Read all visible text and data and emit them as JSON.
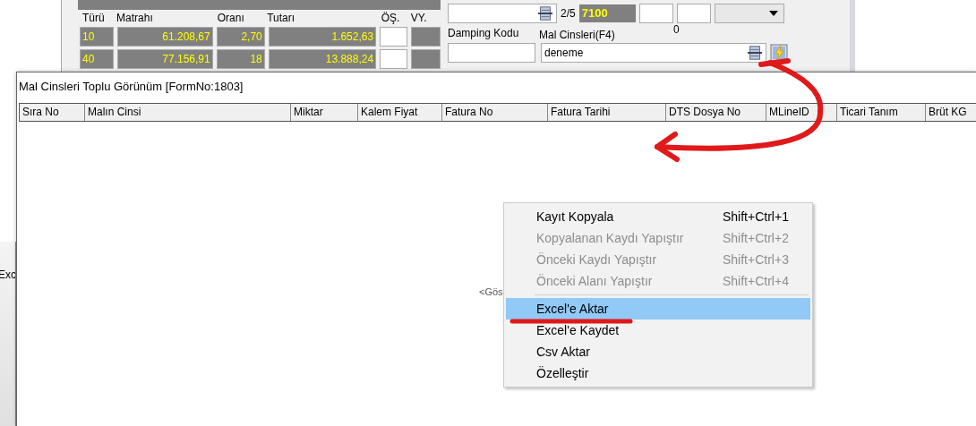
{
  "background_form": {
    "tax_table": {
      "columns": [
        "Türü",
        "Matrahı",
        "Oranı",
        "Tutarı",
        "ÖŞ.",
        "VY."
      ],
      "rows": [
        {
          "type": "10",
          "base": "61.208,67",
          "rate": "2,70",
          "amount": "1.652,63",
          "checked": false
        },
        {
          "type": "40",
          "base": "77.156,91",
          "rate": "18",
          "amount": "13.888,24",
          "checked": false
        }
      ]
    },
    "pager": "2/5",
    "code": "7100",
    "count": "0",
    "damping_label": "Damping Kodu",
    "goods_label": "Mal Cinsleri(F4)",
    "goods_value": "deneme",
    "side_tab": "Exc"
  },
  "window": {
    "title": "Mal Cinsleri Toplu Görünüm [FormNo:1803]",
    "columns": [
      "Sıra No",
      "Malın Cinsi",
      "Miktar",
      "Kalem Fiyat",
      "Fatura No",
      "Fatura Tarihi",
      "DTS Dosya No",
      "MLineID",
      "Ticari Tanım",
      "Brüt KG"
    ],
    "empty_text": "<Gös"
  },
  "context_menu": {
    "items": [
      {
        "kind": "item",
        "label": "Kayıt Kopyala",
        "shortcut": "Shift+Ctrl+1",
        "disabled": false,
        "selected": false
      },
      {
        "kind": "item",
        "label": "Kopyalanan Kaydı Yapıştır",
        "shortcut": "Shift+Ctrl+2",
        "disabled": true,
        "selected": false
      },
      {
        "kind": "item",
        "label": "Önceki Kaydı Yapıştır",
        "shortcut": "Shift+Ctrl+3",
        "disabled": true,
        "selected": false
      },
      {
        "kind": "item",
        "label": "Önceki Alanı Yapıştır",
        "shortcut": "Shift+Ctrl+4",
        "disabled": true,
        "selected": false
      },
      {
        "kind": "separator"
      },
      {
        "kind": "item",
        "label": "Excel'e Aktar",
        "disabled": false,
        "selected": true
      },
      {
        "kind": "item",
        "label": "Excel'e Kaydet",
        "disabled": false,
        "selected": false
      },
      {
        "kind": "item",
        "label": "Csv Aktar",
        "disabled": false,
        "selected": false
      },
      {
        "kind": "item",
        "label": "Özelleştir",
        "disabled": false,
        "selected": false
      }
    ]
  }
}
